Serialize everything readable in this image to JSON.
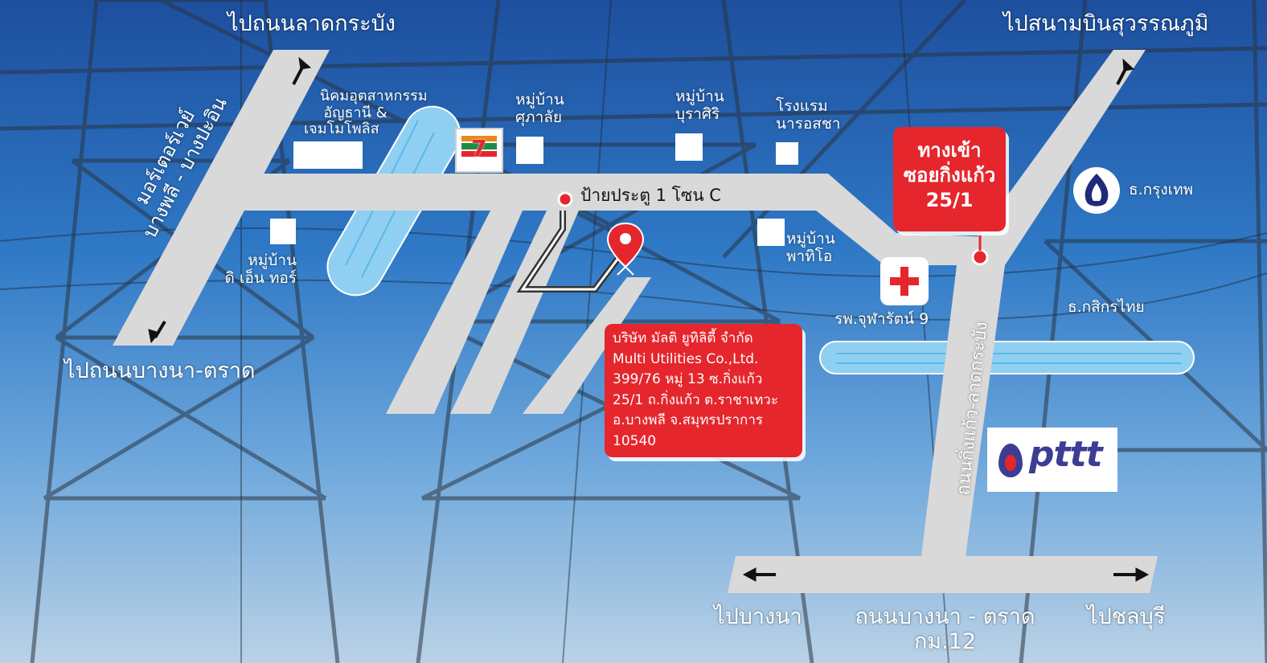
{
  "directions": {
    "to_lat_krabang": "ไปถนนลาดกระบัง",
    "to_suvarnabhumi": "ไปสนามบินสุวรรณภูมิ",
    "to_bangna_trat": "ไปถนนบางนา-ตราด",
    "to_bangna": "ไปบางนา",
    "to_chonburi": "ไปชลบุรี"
  },
  "roads": {
    "motorway_line1": "มอร์เตอร์เวย์",
    "motorway_line2": "บางพลี - บางปะอิน",
    "king_kaeo_lat_krabang": "ถนนกิ่งแก้ว-ลาดกระบัง",
    "bangna_trat_line1": "ถนนบางนา - ตราด",
    "bangna_trat_line2": "กม.12"
  },
  "landmarks": {
    "industrial_line1": "นิคมอุตสาหกรรม",
    "industrial_line2": "อัญธานี &",
    "industrial_line3": "เจมโมโพลิส",
    "village_sukalai_line1": "หมู่บ้าน",
    "village_sukalai_line2": "ศุภาลัย",
    "village_burasiri_line1": "หมู่บ้าน",
    "village_burasiri_line2": "บุราศิริ",
    "hotel_line1": "โรงแรม",
    "hotel_line2": "นารอสชา",
    "village_dn_line1": "หมู่บ้าน",
    "village_dn_line2": "ดิ เอ็น ทอร์",
    "village_pathio_line1": "หมู่บ้าน",
    "village_pathio_line2": "พาทิโอ",
    "gate": "ป้ายประตู 1 โซน C",
    "hospital": "รพ.จุฬารัตน์ 9",
    "bangkok_bank": "ธ.กรุงเทพ",
    "kasikorn_bank": "ธ.กสิกรไทย"
  },
  "entrance": {
    "line1": "ทางเข้า",
    "line2": "ซอยกิ่งแก้ว",
    "line3": "25/1"
  },
  "address": {
    "line1": "บริษัท มัลติ ยูทิลิตี้ จำกัด",
    "line2": "Multi Utilities Co.,Ltd.",
    "line3": "399/76 หมู่ 13 ซ.กิ่งแก้ว",
    "line4": "25/1 ถ.กิ่งแก้ว ต.ราชาเทวะ",
    "line5": "อ.บางพลี จ.สมุทรปราการ",
    "line6": "10540"
  },
  "logos": {
    "ptt": "pttt",
    "seven_eleven": "7"
  },
  "colors": {
    "road": "#d9d9d9",
    "canal": "#8fd0f2",
    "callout_red": "#e5262d",
    "sky_top": "#1d4f9e",
    "ptt_blue": "#3b3e94"
  },
  "icons": {
    "pin": "map-pin-icon",
    "hospital": "red-cross-icon",
    "bank": "bangkok-bank-lotus-icon"
  }
}
